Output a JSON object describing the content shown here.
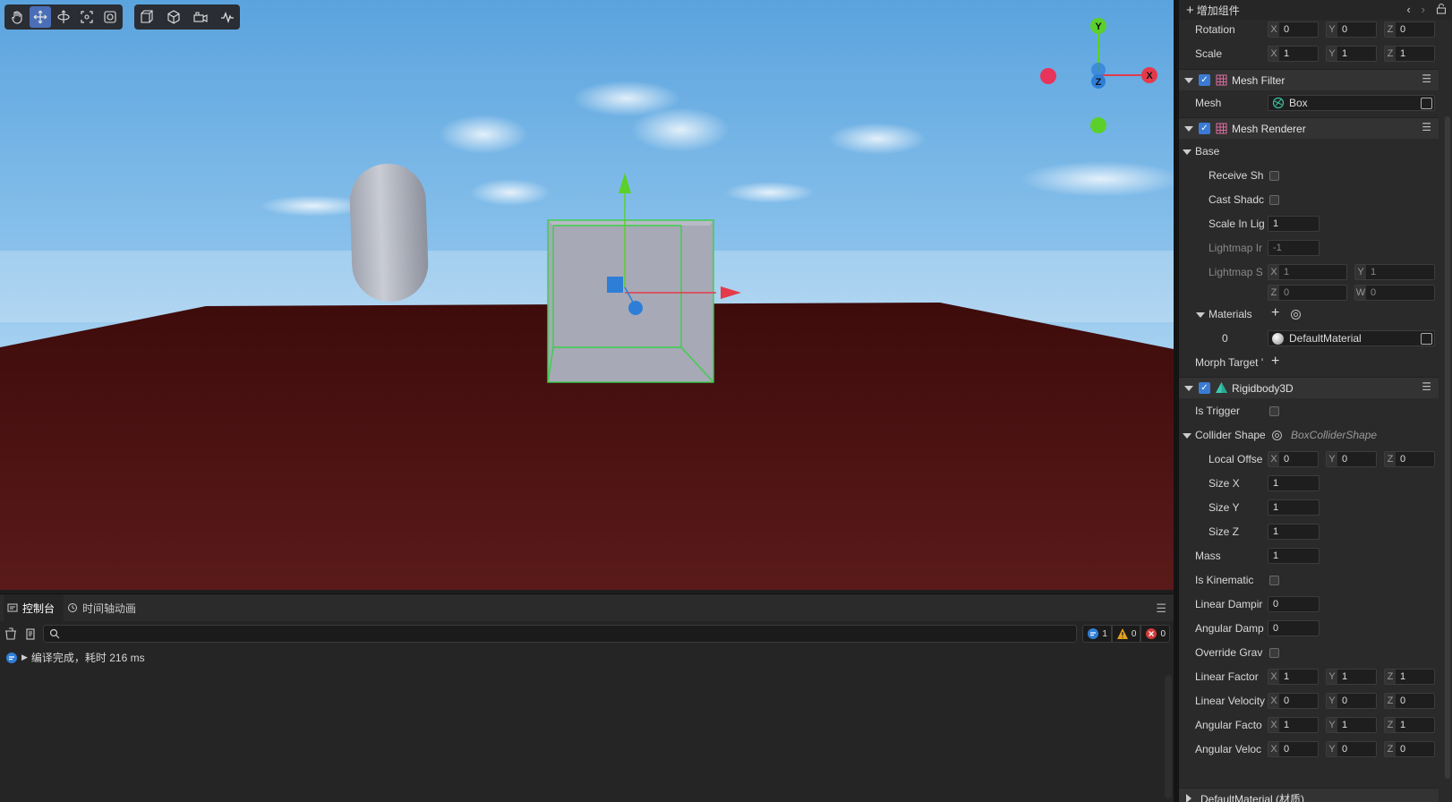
{
  "viewport": {
    "toolbar1": [
      {
        "name": "hand-tool-button",
        "icon": "hand-icon",
        "active": false
      },
      {
        "name": "move-tool-button",
        "icon": "move-icon",
        "active": true
      },
      {
        "name": "rotate-tool-button",
        "icon": "rotate-icon",
        "active": false
      },
      {
        "name": "scale-tool-button",
        "icon": "scale-icon",
        "active": false
      },
      {
        "name": "rect-tool-button",
        "icon": "rect-icon",
        "active": false
      }
    ],
    "toolbar2": [
      {
        "name": "local-global-button",
        "icon": "cube-frame-icon"
      },
      {
        "name": "perspective-button",
        "icon": "cube-icon"
      },
      {
        "name": "camera-button",
        "icon": "camera-icon"
      },
      {
        "name": "stats-button",
        "icon": "pulse-icon"
      }
    ],
    "gizmo_axes": {
      "y": "Y",
      "x": "X",
      "z": "Z"
    },
    "colors": {
      "sky_top": "#5ea6dc",
      "sky_bottom": "#b5d8f2",
      "ground": "#4a1212",
      "selection": "#39d04a",
      "x_axis": "#e53a4a",
      "y_axis": "#5bd02a",
      "z_axis": "#2e7ed8"
    }
  },
  "console": {
    "tabs": [
      {
        "label": "控制台",
        "icon": "console-icon",
        "active": true
      },
      {
        "label": "时间轴动画",
        "icon": "clock-icon",
        "active": false
      }
    ],
    "search_placeholder": "",
    "counts": {
      "info": "1",
      "warn": "0",
      "error": "0"
    },
    "log": "编译完成，耗时 216 ms"
  },
  "inspector": {
    "add_component": "增加组件",
    "transform": {
      "rotation": {
        "label": "Rotation",
        "x": "0",
        "y": "0",
        "z": "0"
      },
      "scale": {
        "label": "Scale",
        "x": "1",
        "y": "1",
        "z": "1"
      }
    },
    "mesh_filter": {
      "title": "Mesh Filter",
      "mesh_label": "Mesh",
      "mesh_value": "Box"
    },
    "mesh_renderer": {
      "title": "Mesh Renderer",
      "base": "Base",
      "receive_shadow": "Receive Sh",
      "cast_shadow": "Cast Shadc",
      "scale_in_lightmap": "Scale In Lig",
      "scale_in_lightmap_value": "1",
      "lightmap_index": "Lightmap Ir",
      "lightmap_index_value": "-1",
      "lightmap_scale": "Lightmap S",
      "lightmap_scale_x": "1",
      "lightmap_scale_y": "1",
      "lightmap_scale_z": "0",
      "lightmap_scale_w": "0",
      "materials": "Materials",
      "material_index": "0",
      "material_value": "DefaultMaterial",
      "morph_target": "Morph Target '"
    },
    "rigidbody": {
      "title": "Rigidbody3D",
      "is_trigger": "Is Trigger",
      "collider_shape": "Collider Shape",
      "collider_shape_value": "BoxColliderShape",
      "local_offset": "Local Offse",
      "local_offset_x": "0",
      "local_offset_y": "0",
      "local_offset_z": "0",
      "size_x": "Size X",
      "size_x_value": "1",
      "size_y": "Size Y",
      "size_y_value": "1",
      "size_z": "Size Z",
      "size_z_value": "1",
      "mass": "Mass",
      "mass_value": "1",
      "is_kinematic": "Is Kinematic",
      "linear_damping": "Linear Dampir",
      "linear_damping_value": "0",
      "angular_damping": "Angular Damp",
      "angular_damping_value": "0",
      "override_gravity": "Override Grav",
      "linear_factor": "Linear Factor",
      "linear_factor_x": "1",
      "linear_factor_y": "1",
      "linear_factor_z": "1",
      "linear_velocity": "Linear Velocity",
      "linear_velocity_x": "0",
      "linear_velocity_y": "0",
      "linear_velocity_z": "0",
      "angular_factor": "Angular Facto",
      "angular_factor_x": "1",
      "angular_factor_y": "1",
      "angular_factor_z": "1",
      "angular_velocity": "Angular Veloc",
      "angular_velocity_x": "0",
      "angular_velocity_y": "0",
      "angular_velocity_z": "0"
    },
    "default_material_section": "DefaultMaterial (材质)"
  }
}
